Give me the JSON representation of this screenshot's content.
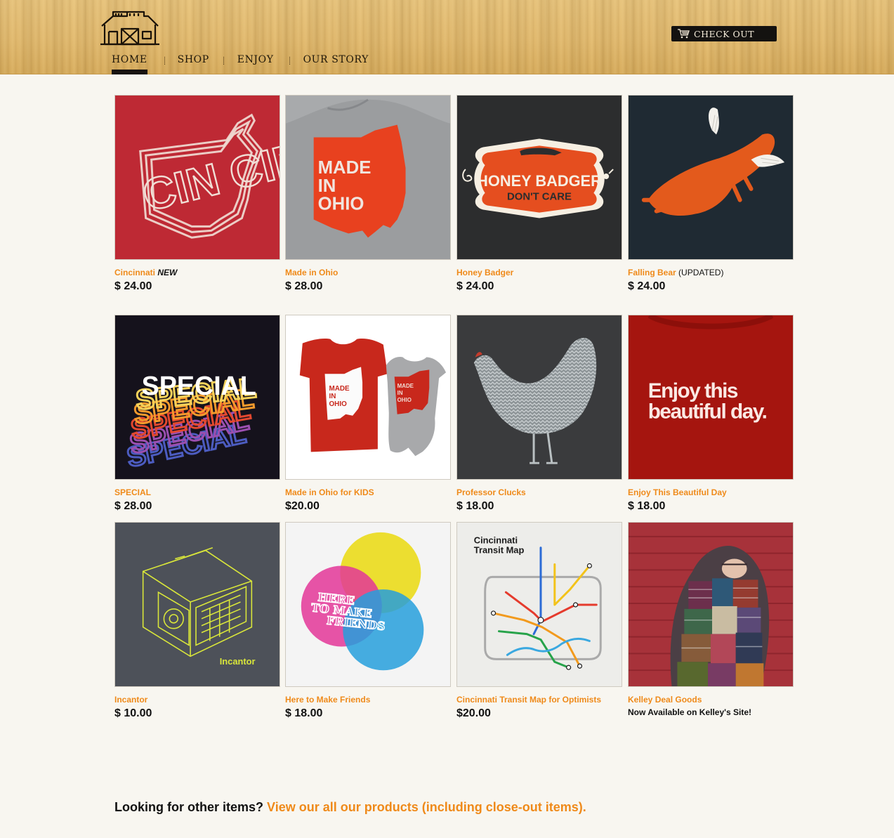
{
  "nav": {
    "items": [
      {
        "label": "HOME",
        "active": true
      },
      {
        "label": "SHOP",
        "active": false
      },
      {
        "label": "ENJOY",
        "active": false
      },
      {
        "label": "OUR STORY",
        "active": false
      }
    ],
    "checkout_label": "CHECK OUT",
    "checkout_icon": "cart-icon",
    "logo_icon": "barn-logo"
  },
  "products": [
    {
      "name": "Cincinnati",
      "tag": "NEW",
      "price": "$ 24.00",
      "image": "cincinnati-shirt"
    },
    {
      "name": "Made in Ohio",
      "price": "$ 28.00",
      "image": "made-in-ohio-shirt"
    },
    {
      "name": "Honey Badger",
      "price": "$ 24.00",
      "image": "honey-badger-shirt"
    },
    {
      "name": "Falling Bear",
      "note": "(UPDATED)",
      "price": "$ 24.00",
      "image": "falling-bear-shirt"
    },
    {
      "name": "SPECIAL",
      "price": "$ 28.00",
      "image": "special-shirt"
    },
    {
      "name": "Made in Ohio for KIDS",
      "price": "$20.00",
      "image": "made-in-ohio-kids"
    },
    {
      "name": "Professor Clucks",
      "price": "$ 18.00",
      "image": "professor-clucks-shirt"
    },
    {
      "name": "Enjoy This Beautiful Day",
      "price": "$ 18.00",
      "image": "enjoy-day-shirt"
    },
    {
      "name": "Incantor",
      "price": "$ 10.00",
      "image": "incantor-shirt"
    },
    {
      "name": "Here to Make Friends",
      "price": "$ 18.00",
      "image": "make-friends-shirt"
    },
    {
      "name": "Cincinnati Transit Map for Optimists",
      "price": "$20.00",
      "image": "transit-map-shirt"
    },
    {
      "name": "Kelley Deal Goods",
      "availability": "Now Available on Kelley's Site!",
      "image": "kelley-deal-photo"
    }
  ],
  "image_text": {
    "cincinnati": "CIN CIN NATI",
    "made_in_ohio": [
      "MADE",
      "IN",
      "OHIO"
    ],
    "honey_badger": [
      "HONEY BADGER",
      "DON'T CARE"
    ],
    "special": "SPECIAL",
    "kids_tee": [
      "MADE",
      "IN",
      "OHIO"
    ],
    "enjoy_day": [
      "Enjoy this",
      "beautiful day."
    ],
    "incantor": "Incantor",
    "make_friends": [
      "HERE",
      "TO MAKE",
      "FRIENDS"
    ],
    "transit_map": [
      "Cincinnati",
      "Transit Map"
    ]
  },
  "footer": {
    "prefix": "Looking for other items? ",
    "link": "View our all our products (including close-out items)."
  },
  "colors": {
    "accent": "#ef8a1a",
    "header_wood": "#e2ba6f",
    "text": "#111111",
    "background": "#f8f6f0"
  }
}
